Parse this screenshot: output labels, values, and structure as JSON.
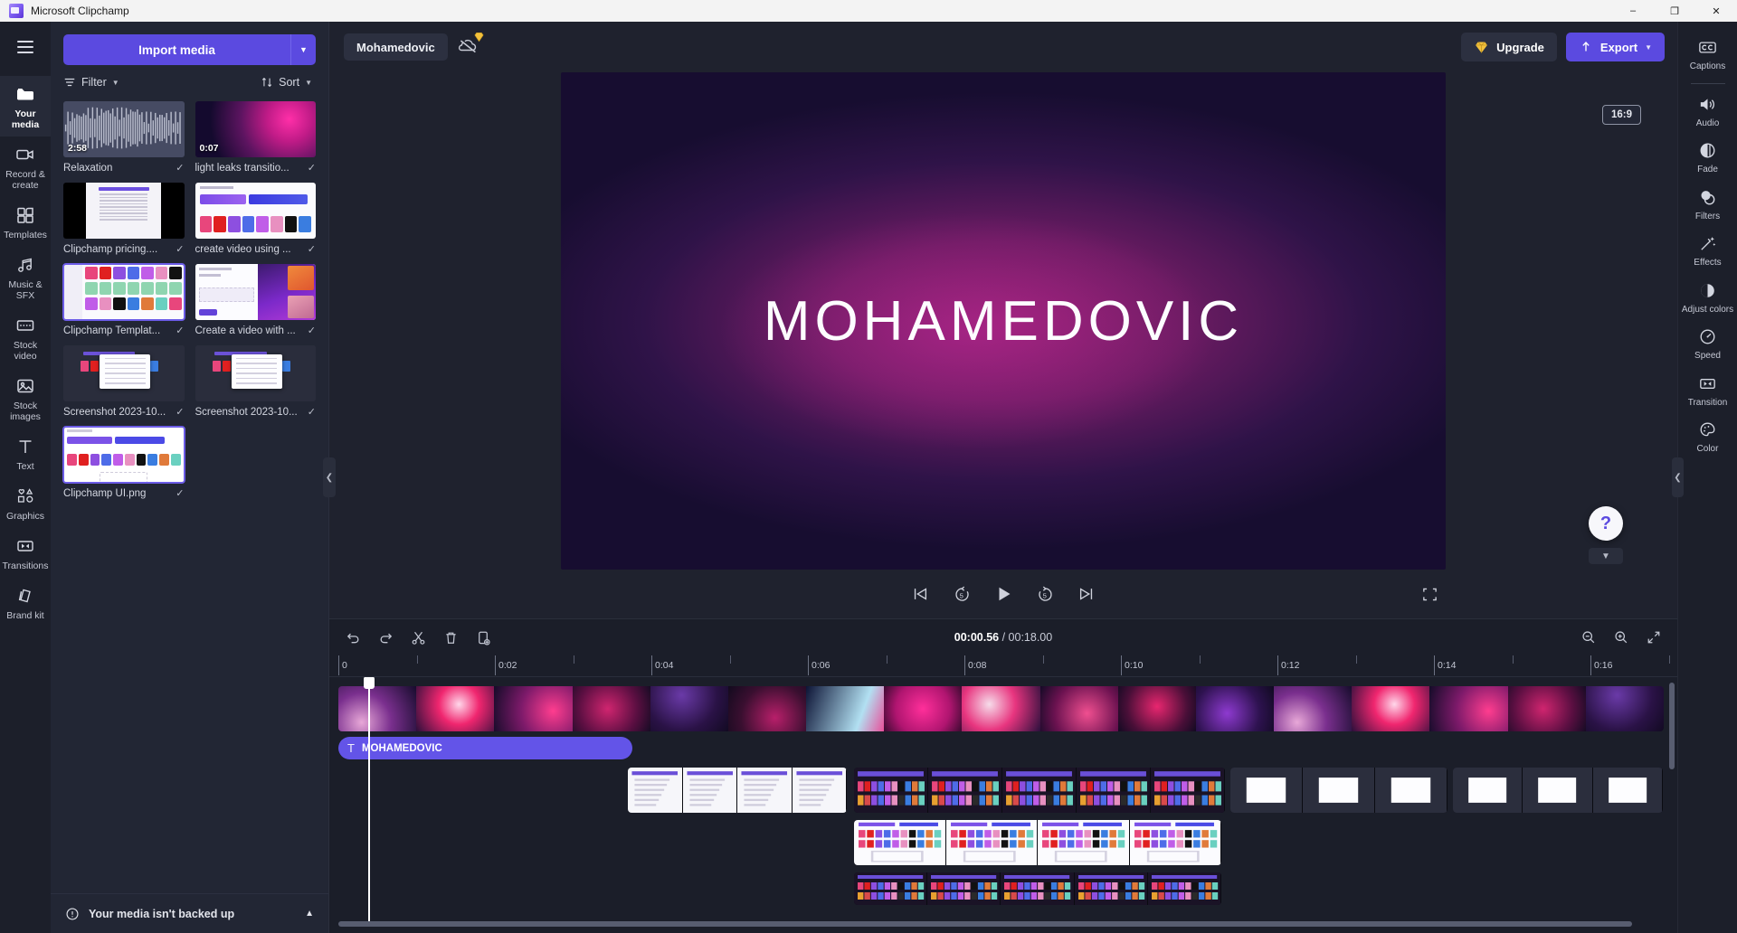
{
  "window": {
    "app_title": "Microsoft Clipchamp",
    "logo_icon": "clipchamp-logo-icon",
    "minimize_label": "–",
    "maximize_label": "❐",
    "close_label": "✕"
  },
  "left_rail": {
    "menu_icon": "hamburger-menu-icon",
    "items": [
      {
        "label": "Your media",
        "icon": "folder-icon",
        "active": true
      },
      {
        "label": "Record & create",
        "icon": "video-camera-icon",
        "active": false
      },
      {
        "label": "Templates",
        "icon": "templates-grid-icon",
        "active": false
      },
      {
        "label": "Music & SFX",
        "icon": "music-note-icon",
        "active": false
      },
      {
        "label": "Stock video",
        "icon": "film-strip-icon",
        "active": false
      },
      {
        "label": "Stock images",
        "icon": "image-icon",
        "active": false
      },
      {
        "label": "Text",
        "icon": "text-t-icon",
        "active": false
      },
      {
        "label": "Graphics",
        "icon": "shapes-icon",
        "active": false
      },
      {
        "label": "Transitions",
        "icon": "transition-icon",
        "active": false
      },
      {
        "label": "Brand kit",
        "icon": "brand-kit-icon",
        "active": false
      }
    ]
  },
  "media_panel": {
    "import_label": "Import media",
    "import_caret_icon": "chevron-down-icon",
    "filter_label": "Filter",
    "filter_icon": "filter-lines-icon",
    "sort_label": "Sort",
    "sort_icon": "sort-arrows-icon",
    "collapse_icon": "chevron-left-icon",
    "items": [
      {
        "name": "Relaxation",
        "duration": "2:58",
        "art": "wave",
        "checked": true,
        "selected": false
      },
      {
        "name": "light leaks transitio...",
        "duration": "0:07",
        "art": "grad1",
        "checked": true,
        "selected": false
      },
      {
        "name": "Clipchamp pricing....",
        "duration": "",
        "art": "doc",
        "checked": true,
        "selected": false
      },
      {
        "name": "create video using ...",
        "duration": "",
        "art": "web",
        "checked": true,
        "selected": false
      },
      {
        "name": "Clipchamp Templat...",
        "duration": "",
        "art": "tpl",
        "checked": true,
        "selected": true
      },
      {
        "name": "Create a video with ...",
        "duration": "",
        "art": "purple",
        "checked": true,
        "selected": false
      },
      {
        "name": "Screenshot 2023-10...",
        "duration": "",
        "art": "ss",
        "checked": true,
        "selected": false
      },
      {
        "name": "Screenshot 2023-10...",
        "duration": "",
        "art": "ss",
        "checked": true,
        "selected": false
      },
      {
        "name": "Clipchamp UI.png",
        "duration": "",
        "art": "ui",
        "checked": true,
        "selected": true
      }
    ],
    "backup_notice": "Your media isn't backed up",
    "backup_icon": "warning-circle-icon",
    "backup_chevron_icon": "chevron-up-icon"
  },
  "topbar": {
    "project_tab": "Mohamedovic",
    "cloud_off_icon": "cloud-off-icon",
    "premium_badge_icon": "diamond-badge-icon",
    "upgrade_label": "Upgrade",
    "upgrade_icon": "diamond-icon",
    "export_label": "Export",
    "export_icon": "upload-arrow-icon",
    "export_caret_icon": "chevron-down-icon"
  },
  "stage": {
    "aspect_ratio": "16:9",
    "preview_text": "MOHAMEDOVIC",
    "controls": [
      {
        "name": "skip-to-start-button",
        "icon": "skip-previous-icon"
      },
      {
        "name": "rewind-5s-button",
        "icon": "rewind-5-icon"
      },
      {
        "name": "play-button",
        "icon": "play-icon"
      },
      {
        "name": "forward-5s-button",
        "icon": "forward-5-icon"
      },
      {
        "name": "skip-to-end-button",
        "icon": "skip-next-icon"
      }
    ],
    "fullscreen_icon": "fullscreen-icon",
    "help_icon": "question-mark-icon",
    "collapse_icon": "chevron-down-icon"
  },
  "timeline": {
    "tools": [
      {
        "name": "undo-button",
        "icon": "undo-arrow-icon"
      },
      {
        "name": "redo-button",
        "icon": "redo-arrow-icon"
      },
      {
        "name": "split-button",
        "icon": "scissors-icon"
      },
      {
        "name": "delete-button",
        "icon": "trash-icon"
      },
      {
        "name": "duplicate-button",
        "icon": "duplicate-icon"
      }
    ],
    "current_time": "00:00.56",
    "time_separator": " / ",
    "total_time": "00:18.00",
    "zoom_out_icon": "magnifier-minus-icon",
    "zoom_in_icon": "magnifier-plus-icon",
    "fit_icon": "fit-to-screen-icon",
    "ruler_labels": [
      "0",
      "0:02",
      "0:04",
      "0:06",
      "0:08",
      "0:10",
      "0:12",
      "0:14",
      "0:16"
    ],
    "playhead_time": "00:00.56",
    "tracks": [
      {
        "name": "video-track-1",
        "clip_label": ""
      },
      {
        "name": "text-track",
        "clip_label": "MOHAMEDOVIC",
        "clip_icon": "text-t-icon"
      },
      {
        "name": "image-track-1",
        "clip_label": ""
      },
      {
        "name": "image-track-2",
        "clip_label": ""
      },
      {
        "name": "image-track-3",
        "clip_label": ""
      }
    ]
  },
  "right_rail": {
    "items": [
      {
        "label": "Captions",
        "icon": "closed-captions-icon"
      },
      {
        "label": "Audio",
        "icon": "speaker-icon"
      },
      {
        "label": "Fade",
        "icon": "fade-circle-icon"
      },
      {
        "label": "Filters",
        "icon": "filters-circles-icon"
      },
      {
        "label": "Effects",
        "icon": "magic-wand-icon"
      },
      {
        "label": "Adjust colors",
        "icon": "half-circle-icon"
      },
      {
        "label": "Speed",
        "icon": "speedometer-icon"
      },
      {
        "label": "Transition",
        "icon": "transition-icon"
      },
      {
        "label": "Color",
        "icon": "palette-icon"
      }
    ],
    "collapse_icon": "chevron-left-icon"
  },
  "colors": {
    "accent": "#5b4ae0",
    "panel": "#222634",
    "rail": "#1c1f2a",
    "timeline": "#1b1e29",
    "upgrade_gold": "#f2c13d"
  }
}
